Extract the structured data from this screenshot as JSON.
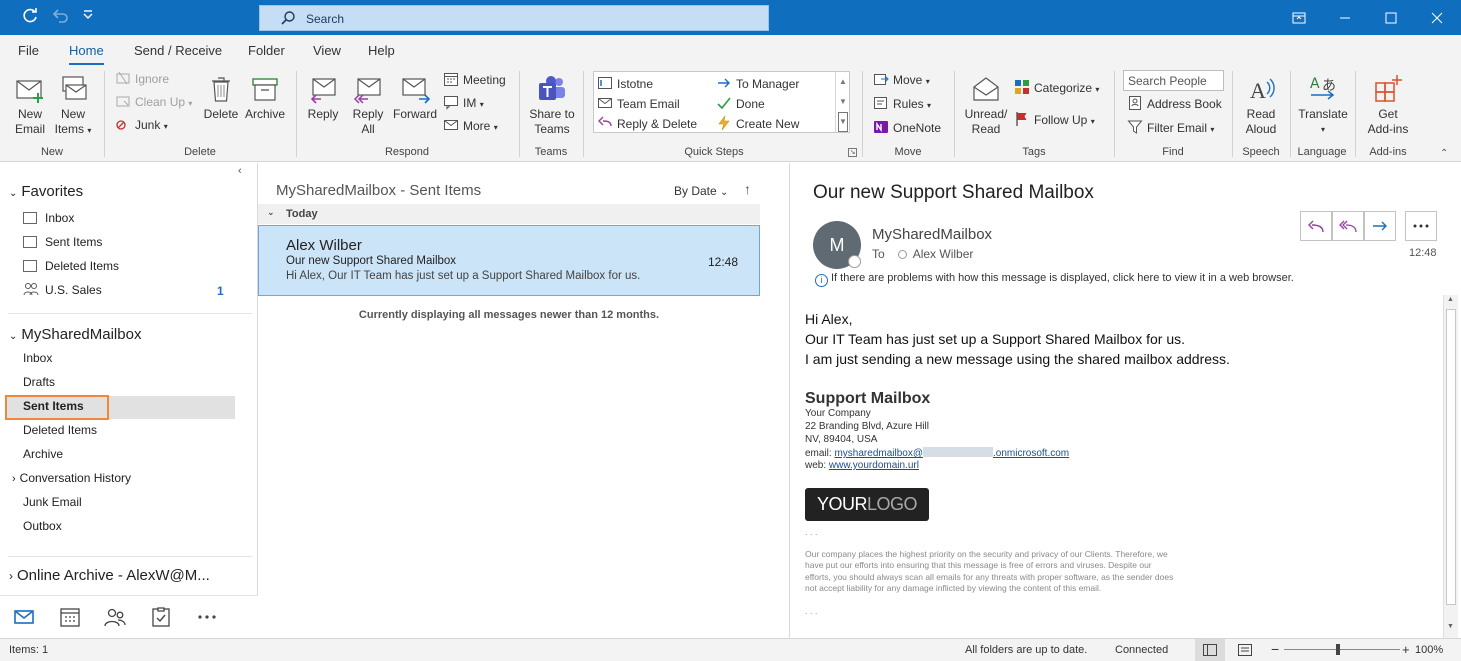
{
  "titlebar": {
    "search_placeholder": "Search"
  },
  "menu": {
    "tabs": [
      "File",
      "Home",
      "Send / Receive",
      "Folder",
      "View",
      "Help"
    ],
    "active": "Home"
  },
  "ribbon": {
    "new": {
      "new_email": [
        "New",
        "Email"
      ],
      "new_items": [
        "New",
        "Items"
      ],
      "group": "New"
    },
    "delete": {
      "ignore": "Ignore",
      "clean_up": "Clean Up",
      "junk": "Junk",
      "delete": "Delete",
      "archive": "Archive",
      "group": "Delete"
    },
    "respond": {
      "reply": "Reply",
      "reply_all": [
        "Reply",
        "All"
      ],
      "forward": "Forward",
      "meeting": "Meeting",
      "im": "IM",
      "more": "More",
      "group": "Respond"
    },
    "teams": {
      "share": [
        "Share to",
        "Teams"
      ],
      "group": "Teams"
    },
    "quick_steps": {
      "items": [
        "Istotne",
        "To Manager",
        "Team Email",
        "Done",
        "Reply & Delete",
        "Create New"
      ],
      "group": "Quick Steps"
    },
    "move": {
      "move": "Move",
      "rules": "Rules",
      "onenote": "OneNote",
      "group": "Move"
    },
    "tags": {
      "unread_read": [
        "Unread/",
        "Read"
      ],
      "categorize": "Categorize",
      "follow_up": "Follow Up",
      "group": "Tags"
    },
    "find": {
      "search_people": "Search People",
      "address_book": "Address Book",
      "filter_email": "Filter Email",
      "group": "Find"
    },
    "speech": {
      "read_aloud": [
        "Read",
        "Aloud"
      ],
      "group": "Speech"
    },
    "language": {
      "translate": "Translate",
      "group": "Language"
    },
    "addins": {
      "get_addins": [
        "Get",
        "Add-ins"
      ],
      "group": "Add-ins"
    }
  },
  "folders": {
    "favorites_header": "Favorites",
    "favorites": [
      "Inbox",
      "Sent Items",
      "Deleted Items",
      "U.S. Sales"
    ],
    "us_sales_count": "1",
    "mailbox_header": "MySharedMailbox",
    "mailbox_items": [
      "Inbox",
      "Drafts",
      "Sent Items",
      "Deleted Items",
      "Archive",
      "Conversation History",
      "Junk Email",
      "Outbox"
    ],
    "archive_header": "Online Archive - AlexW@M..."
  },
  "message_list": {
    "title": "MySharedMailbox - Sent Items",
    "sort": "By Date",
    "group": "Today",
    "items": [
      {
        "from": "Alex Wilber",
        "subject": "Our new Support Shared Mailbox",
        "preview": "Hi Alex,  Our IT Team has just set up a Support Shared Mailbox for us.",
        "time": "12:48"
      }
    ],
    "note": "Currently displaying all messages newer than 12 months."
  },
  "reading": {
    "subject": "Our new Support Shared Mailbox",
    "avatar_initial": "M",
    "sender": "MySharedMailbox",
    "to_label": "To",
    "to": "Alex Wilber",
    "time": "12:48",
    "info": "If there are problems with how this message is displayed, click here to view it in a web browser.",
    "body": [
      "Hi Alex,",
      "Our IT Team has just set up a Support Shared Mailbox for us.",
      "I am just sending a new message using the shared mailbox address."
    ],
    "signature": {
      "name": "Support Mailbox",
      "company": "Your Company",
      "address1": "22 Branding Blvd, Azure Hill",
      "address2": "NV, 89404, USA",
      "email_label": "email:",
      "email_start": "mysharedmailbox@",
      "email_end": ".onmicrosoft.com",
      "web_label": "web:",
      "web": "www.yourdomain.url",
      "logo_a": "YOUR",
      "logo_b": "LOGO",
      "dots": ". . .",
      "disclaimer": "Our company places the highest priority on the security and privacy of our Clients. Therefore, we have put our efforts into ensuring that this message is free of errors and viruses. Despite our efforts, you should always scan all emails for any threats with proper software, as the sender does not accept liability for any damage inflicted by viewing the content of this email."
    }
  },
  "status": {
    "items": "Items: 1",
    "sync": "All folders are up to date.",
    "connection": "Connected",
    "zoom": "100%"
  }
}
